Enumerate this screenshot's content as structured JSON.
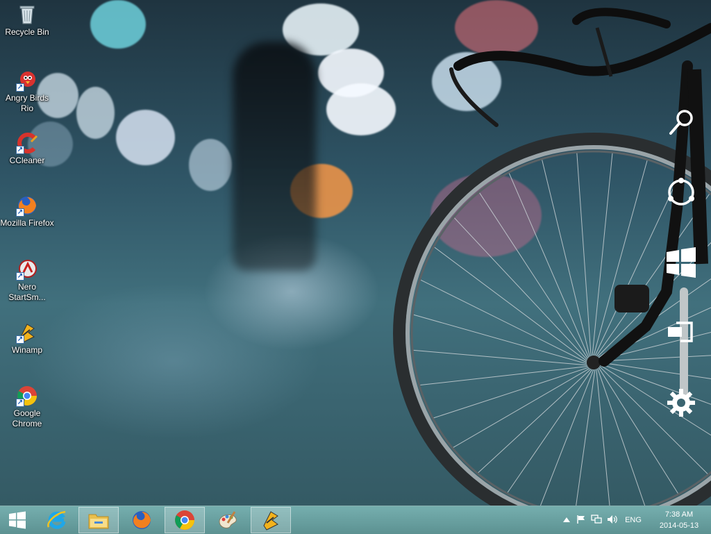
{
  "desktop": {
    "icons": [
      {
        "label": "Recycle Bin",
        "icon": "recycle-bin-icon"
      },
      {
        "label": "Angry Birds Rio",
        "icon": "angry-birds-icon"
      },
      {
        "label": "CCleaner",
        "icon": "ccleaner-icon"
      },
      {
        "label": "Mozilla Firefox",
        "icon": "firefox-icon"
      },
      {
        "label": "Nero StartSm...",
        "icon": "nero-icon"
      },
      {
        "label": "Winamp",
        "icon": "winamp-icon"
      },
      {
        "label": "Google Chrome",
        "icon": "chrome-icon"
      }
    ]
  },
  "charms": [
    "search-icon",
    "share-icon",
    "start-icon",
    "devices-icon",
    "settings-icon"
  ],
  "taskbar": {
    "apps": [
      "internet-explorer-icon",
      "file-explorer-icon",
      "firefox-icon",
      "chrome-icon",
      "paint-icon",
      "winamp-icon"
    ],
    "language": "ENG",
    "time": "7:38 AM",
    "date": "2014-05-13"
  },
  "colors": {
    "taskbar": "#6aa8a8",
    "accent": "#ffffff"
  }
}
